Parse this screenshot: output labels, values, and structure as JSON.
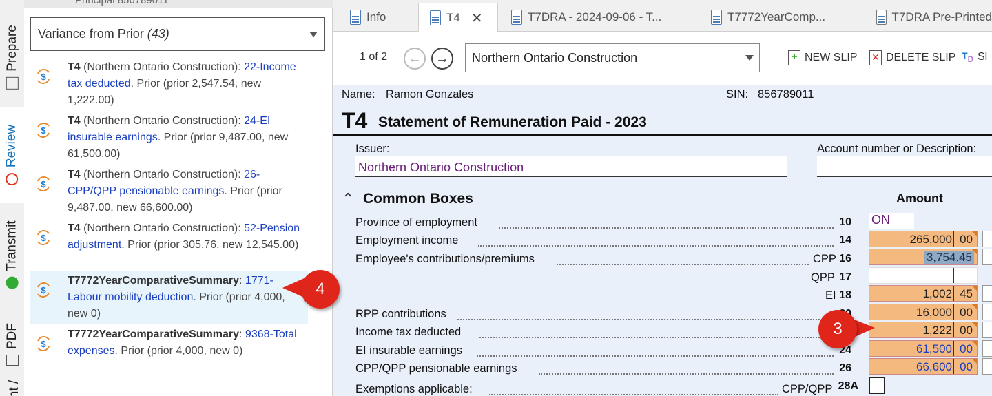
{
  "rail": {
    "tabs": [
      {
        "label": "Prepare"
      },
      {
        "label": "Review"
      },
      {
        "label": "Transmit"
      },
      {
        "label": "PDF"
      },
      {
        "label": "nt /"
      }
    ]
  },
  "left_panel": {
    "top_cut_text": "Principal  856789011",
    "filter": {
      "label": "Variance from Prior",
      "count": "(43)"
    },
    "items": [
      {
        "form": "T4",
        "context": " (Northern Ontario Construction): ",
        "link": "22-Income tax deducted",
        "tail": ". Prior (prior 2,547.54, new 1,222.00)"
      },
      {
        "form": "T4",
        "context": " (Northern Ontario Construction): ",
        "link": "24-EI insurable earnings",
        "tail": ". Prior (prior 9,487.00, new 61,500.00)"
      },
      {
        "form": "T4",
        "context": " (Northern Ontario Construction): ",
        "link": "26-CPP/QPP pensionable earnings",
        "tail": ". Prior (prior 9,487.00, new 66,600.00)"
      },
      {
        "form": "T4",
        "context": " (Northern Ontario Construction): ",
        "link": "52-Pension adjustment",
        "tail": ". Prior (prior 305.76, new 12,545.00)"
      },
      {
        "form": "T7772YearComparativeSummary",
        "context": ": ",
        "link": "1771-Labour mobility deduction",
        "tail": ". Prior (prior 4,000, new 0)"
      },
      {
        "form": "T7772YearComparativeSummary",
        "context": ": ",
        "link": "9368-Total expenses",
        "tail": ". Prior (prior 4,000, new 0)"
      }
    ]
  },
  "tabs": [
    {
      "label": "Info"
    },
    {
      "label": "T4"
    },
    {
      "label": "T7DRA - 2024-09-06 - T..."
    },
    {
      "label": "T7772YearComp..."
    },
    {
      "label": "T7DRA Pre-Printed"
    }
  ],
  "toolbar": {
    "pager": "1 of 2",
    "slip": "Northern Ontario Construction",
    "new_slip": "NEW SLIP",
    "delete_slip": "DELETE SLIP",
    "cut": "Sl"
  },
  "form": {
    "name_label": "Name:",
    "name_value": "Ramon Gonzales",
    "sin_label": "SIN:",
    "sin_value": "856789011",
    "title_code": "T4",
    "title_text": "Statement of Remuneration Paid - 2023",
    "issuer_label": "Issuer:",
    "issuer_value": "Northern Ontario Construction",
    "account_label": "Account number or Description:",
    "section": "Common Boxes",
    "amount_header": "Amount",
    "rows": [
      {
        "label": "Province of employment",
        "suffix": "",
        "box": "10",
        "value": "ON",
        "cents": ""
      },
      {
        "label": "Employment income",
        "suffix": "",
        "box": "14",
        "value": "265,000",
        "cents": "00"
      },
      {
        "label": "Employee's contributions/premiums",
        "suffix": "CPP",
        "box": "16",
        "value": "3,754.45",
        "cents": ""
      },
      {
        "label": "",
        "suffix": "QPP",
        "box": "17",
        "value": "",
        "cents": ""
      },
      {
        "label": "",
        "suffix": "EI",
        "box": "18",
        "value": "1,002",
        "cents": "45"
      },
      {
        "label": "RPP contributions",
        "suffix": "",
        "box": "20",
        "value": "16,000",
        "cents": "00"
      },
      {
        "label": "Income tax deducted",
        "suffix": "",
        "box": "22",
        "value": "1,222",
        "cents": "00"
      },
      {
        "label": "EI insurable earnings",
        "suffix": "",
        "box": "24",
        "value": "61,500",
        "cents": "00"
      },
      {
        "label": "CPP/QPP pensionable earnings",
        "suffix": "",
        "box": "26",
        "value": "66,600",
        "cents": "00"
      },
      {
        "label": "Exemptions applicable:",
        "suffix": "CPP/QPP",
        "box": "28A",
        "value": "",
        "cents": ""
      }
    ]
  },
  "callouts": {
    "left": "4",
    "right": "3"
  },
  "colors": {
    "link": "#1a3fbf",
    "amount_fill": "#f4b97f",
    "callout": "#e0261b",
    "issuer_text": "#6a1b7a"
  }
}
